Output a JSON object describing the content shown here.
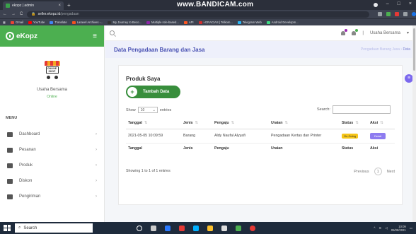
{
  "browser": {
    "tab_title": "ekopz | admin",
    "tab_close": "×",
    "newtab": "+",
    "url_host": "seller.ekopz.id",
    "url_path": "/pengadaan",
    "win_min": "–",
    "win_max": "□",
    "win_close": "×"
  },
  "overlay": {
    "recorder_text": "www.BANDICAM.com"
  },
  "bookmarks": [
    {
      "label": "Gmail",
      "color": "#ea4335"
    },
    {
      "label": "YouTube",
      "color": "#ff0000"
    },
    {
      "label": "Translate",
      "color": "#4285f4"
    },
    {
      "label": "Laravel Archives -...",
      "color": "#f4511e"
    },
    {
      "label": "My Journey to Beco...",
      "color": "#333333"
    },
    {
      "label": "Multiple role-based...",
      "color": "#8e24aa"
    },
    {
      "label": "API",
      "color": "#ff5722"
    },
    {
      "label": "i-GRACIAS | Telkom...",
      "color": "#d32f2f"
    },
    {
      "label": "Telegram Web",
      "color": "#29b6f6"
    },
    {
      "label": "Android Developm...",
      "color": "#3ddc84"
    }
  ],
  "sidebar": {
    "brand": "eKopz",
    "shop_logo_text": "ONLINE SHOP",
    "store_name": "Usaha Bersama",
    "store_status": "Online",
    "menu_title": "MENU",
    "items": [
      {
        "label": "Dashboard",
        "icon": "dashboard-icon"
      },
      {
        "label": "Pesanan",
        "icon": "orders-icon"
      },
      {
        "label": "Produk",
        "icon": "product-icon"
      },
      {
        "label": "Diskon",
        "icon": "percent-icon"
      },
      {
        "label": "Pengiriman",
        "icon": "shipping-icon"
      }
    ]
  },
  "topnav": {
    "user_name": "Usaha Bersama",
    "user_caret": "▾",
    "separator": "|"
  },
  "page": {
    "title": "Data Pengadaan Barang dan Jasa",
    "breadcrumb_prefix": "Pengadaan Barang Jasa",
    "breadcrumb_sep": " › ",
    "breadcrumb_current": "Data"
  },
  "card": {
    "title": "Produk Saya",
    "add_label": "Tambah Data",
    "show_label": "Show",
    "show_value": "10",
    "entries_label": "entries",
    "search_label": "Search:",
    "columns": [
      "Tanggal",
      "Jenis",
      "Pengaju",
      "Uraian",
      "Status",
      "Aksi"
    ],
    "rows": [
      {
        "tanggal": "2021-05-05 10:09:59",
        "jenis": "Barang",
        "pengaju": "Aldy Naufal Alyyafi",
        "uraian": "Pengadaan Kertas dan Printer",
        "status": "On Going",
        "aksi": "Detail"
      }
    ],
    "info": "Showing 1 to 1 of 1 entries",
    "prev": "Previous",
    "page": "1",
    "next": "Next"
  },
  "taskbar": {
    "search_placeholder": "Search",
    "time": "10:09",
    "date": "05/05/2021"
  },
  "colors": {
    "brand_green": "#4caf50",
    "title_indigo": "#4a52b3",
    "status_yellow": "#f5c518",
    "detail_purple": "#8e7cf0"
  }
}
